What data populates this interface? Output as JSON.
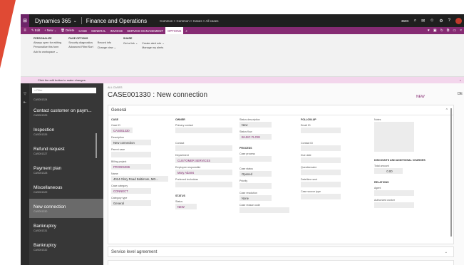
{
  "navbar": {
    "app": "Dynamics 365",
    "app_caret": "⌄",
    "module": "Finance and Operations",
    "breadcrumb": "Common  >  Common  >  Cases  >  All cases",
    "company": "360C"
  },
  "actions": [
    {
      "label": "✎ Edit"
    },
    {
      "label": "+ New ⌄"
    },
    {
      "label": "🗑 Delete"
    },
    {
      "label": "CASE"
    },
    {
      "label": "GENERAL"
    },
    {
      "label": "INVOICE"
    },
    {
      "label": "SERVICE MANAGEMENT"
    },
    {
      "label": "OPTIONS"
    }
  ],
  "ribbon": {
    "personalize": {
      "title": "PERSONALIZE",
      "items": [
        "Always open for editing",
        "Personalize this form",
        "Add to workspace ⌄"
      ]
    },
    "page_options": {
      "title": "PAGE OPTIONS",
      "col1": [
        "Security diagnostics",
        "Advanced Filter/Sort"
      ],
      "col2": [
        "Record info",
        "Change view ⌄"
      ]
    },
    "share": {
      "title": "SHARE",
      "col1": [
        "Get a link ⌄"
      ],
      "col2": [
        "Create alert rule ⌄",
        "Manage my alerts"
      ]
    }
  },
  "infobar": {
    "message": "Click the edit button to make changes.",
    "close": "×"
  },
  "sidebar": {
    "filter_placeholder": "⌕ Filter",
    "items": [
      {
        "name": "",
        "id": "CAS001324"
      },
      {
        "name": "Contact customer on paym...",
        "id": "CAS001325"
      },
      {
        "name": "Inspection",
        "id": "CAS001326"
      },
      {
        "name": "Refund request",
        "id": "CAS001327"
      },
      {
        "name": "Payment plan",
        "id": "CAS001328"
      },
      {
        "name": "Miscellaneous",
        "id": "CAS001329"
      },
      {
        "name": "New connection",
        "id": "CAS001330"
      },
      {
        "name": "Bankruptcy",
        "id": "CAS001331"
      },
      {
        "name": "Bankruptcy",
        "id": "CAS001332"
      }
    ]
  },
  "record": {
    "crumb": "ALL CASES",
    "title": "CASE001330 : New connection",
    "status_flag": "NEW",
    "db": "DE"
  },
  "general": {
    "title": "General",
    "case_header": "CASE",
    "case_id_label": "Case ID",
    "case_id": "CAS001330",
    "description_label": "Description",
    "description": "New connection",
    "parent_case_label": "Parent case",
    "parent_case": "",
    "billing_project_label": "Billing project",
    "billing_project": "PRO001086",
    "name_label": "Name",
    "name": "4014 Glory Road Baltimore, MD...",
    "case_category_label": "Case category",
    "case_category": "CONNECT",
    "category_type_label": "Category type",
    "category_type": "General",
    "owner_header": "OWNER",
    "primary_contact_label": "Primary contact",
    "primary_contact": "",
    "contact_label": "Contact",
    "contact": "",
    "department_label": "Department",
    "department": "CUSTOMER SERVICES",
    "employee_label": "Employee responsible",
    "employee": "Mary Adams",
    "technician_label": "Preferred technician",
    "technician": "",
    "status_header": "STATUS",
    "status_label": "Status",
    "status": "NEW",
    "status_desc_label": "Status description",
    "status_desc": "New",
    "status_flow_label": "Status flow",
    "status_flow": "BASIC FLOW",
    "process_header": "PROCESS",
    "case_process_label": "Case process",
    "case_process": "",
    "case_status_label": "Case status",
    "case_status": "Opened",
    "priority_label": "Priority",
    "priority": "",
    "case_resolution_label": "Case resolution",
    "case_resolution": "None",
    "case_reason_label": "Case reason code",
    "case_reason": "",
    "followup_header": "FOLLOW-UP",
    "email_label": "Email ID",
    "email": "",
    "contact_id_label": "Contact ID",
    "contact_id": "",
    "due_date_label": "Due date",
    "due_date": "",
    "questionnaire_label": "Questionnaire",
    "questionnaire": "",
    "date_sent_label": "Date/time sent",
    "date_sent": "",
    "case_source_label": "Case source type",
    "case_source": "",
    "notes_label": "Notes",
    "discounts_header": "DISCOUNTS AND ADDITIONAL CHARGES",
    "total_amount_label": "Total amount",
    "total_amount": "0.00",
    "relations_header": "RELATIONS",
    "agent_label": "Agent",
    "agent": "",
    "authorized_label": "Authorized worker",
    "authorized": ""
  },
  "sla": {
    "title": "Service level agreement"
  },
  "colors": {
    "accent": "#862b73",
    "navbar": "#1f1f1f",
    "sidebar": "#373737"
  }
}
